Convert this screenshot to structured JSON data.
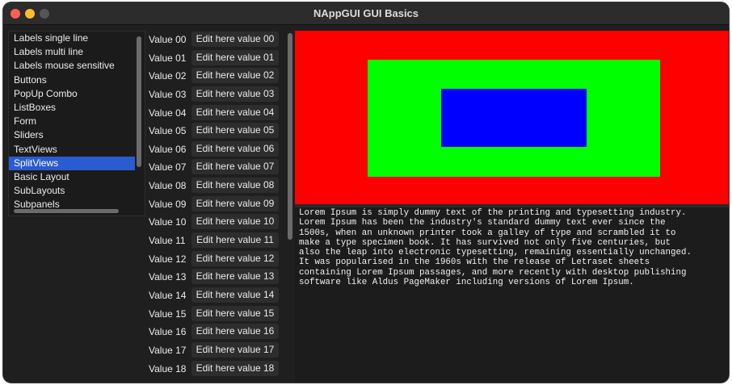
{
  "window": {
    "title": "NAppGUI GUI Basics"
  },
  "sidebar": {
    "items": [
      {
        "label": "Labels single line",
        "selected": false
      },
      {
        "label": "Labels multi line",
        "selected": false
      },
      {
        "label": "Labels mouse sensitive",
        "selected": false
      },
      {
        "label": "Buttons",
        "selected": false
      },
      {
        "label": "PopUp Combo",
        "selected": false
      },
      {
        "label": "ListBoxes",
        "selected": false
      },
      {
        "label": "Form",
        "selected": false
      },
      {
        "label": "Sliders",
        "selected": false
      },
      {
        "label": "TextViews",
        "selected": false
      },
      {
        "label": "SplitViews",
        "selected": true
      },
      {
        "label": "Basic Layout",
        "selected": false
      },
      {
        "label": "SubLayouts",
        "selected": false
      },
      {
        "label": "Subpanels",
        "selected": false
      }
    ]
  },
  "grid": {
    "rows": [
      {
        "label": "Value 00",
        "edit": "Edit here value 00"
      },
      {
        "label": "Value 01",
        "edit": "Edit here value 01"
      },
      {
        "label": "Value 02",
        "edit": "Edit here value 02"
      },
      {
        "label": "Value 03",
        "edit": "Edit here value 03"
      },
      {
        "label": "Value 04",
        "edit": "Edit here value 04"
      },
      {
        "label": "Value 05",
        "edit": "Edit here value 05"
      },
      {
        "label": "Value 06",
        "edit": "Edit here value 06"
      },
      {
        "label": "Value 07",
        "edit": "Edit here value 07"
      },
      {
        "label": "Value 08",
        "edit": "Edit here value 08"
      },
      {
        "label": "Value 09",
        "edit": "Edit here value 09"
      },
      {
        "label": "Value 10",
        "edit": "Edit here value 10"
      },
      {
        "label": "Value 11",
        "edit": "Edit here value 11"
      },
      {
        "label": "Value 12",
        "edit": "Edit here value 12"
      },
      {
        "label": "Value 13",
        "edit": "Edit here value 13"
      },
      {
        "label": "Value 14",
        "edit": "Edit here value 14"
      },
      {
        "label": "Value 15",
        "edit": "Edit here value 15"
      },
      {
        "label": "Value 16",
        "edit": "Edit here value 16"
      },
      {
        "label": "Value 17",
        "edit": "Edit here value 17"
      },
      {
        "label": "Value 18",
        "edit": "Edit here value 18"
      }
    ]
  },
  "view": {
    "colors": {
      "outer": "#ff0000",
      "middle": "#00ff00",
      "inner": "#0000ff"
    }
  },
  "textview": {
    "lines": [
      "Lorem Ipsum is simply dummy text of the printing and typesetting industry.",
      "Lorem Ipsum has been the industry's standard dummy text ever since the",
      "1500s, when an unknown printer took a galley of type and scrambled it to",
      "make a type specimen book. It has survived not only five centuries, but",
      "also the leap into electronic typesetting, remaining essentially unchanged.",
      "It was popularised in the 1960s with the release of Letraset sheets",
      "containing Lorem Ipsum passages, and more recently with desktop publishing",
      "software like Aldus PageMaker including versions of Lorem Ipsum."
    ]
  }
}
